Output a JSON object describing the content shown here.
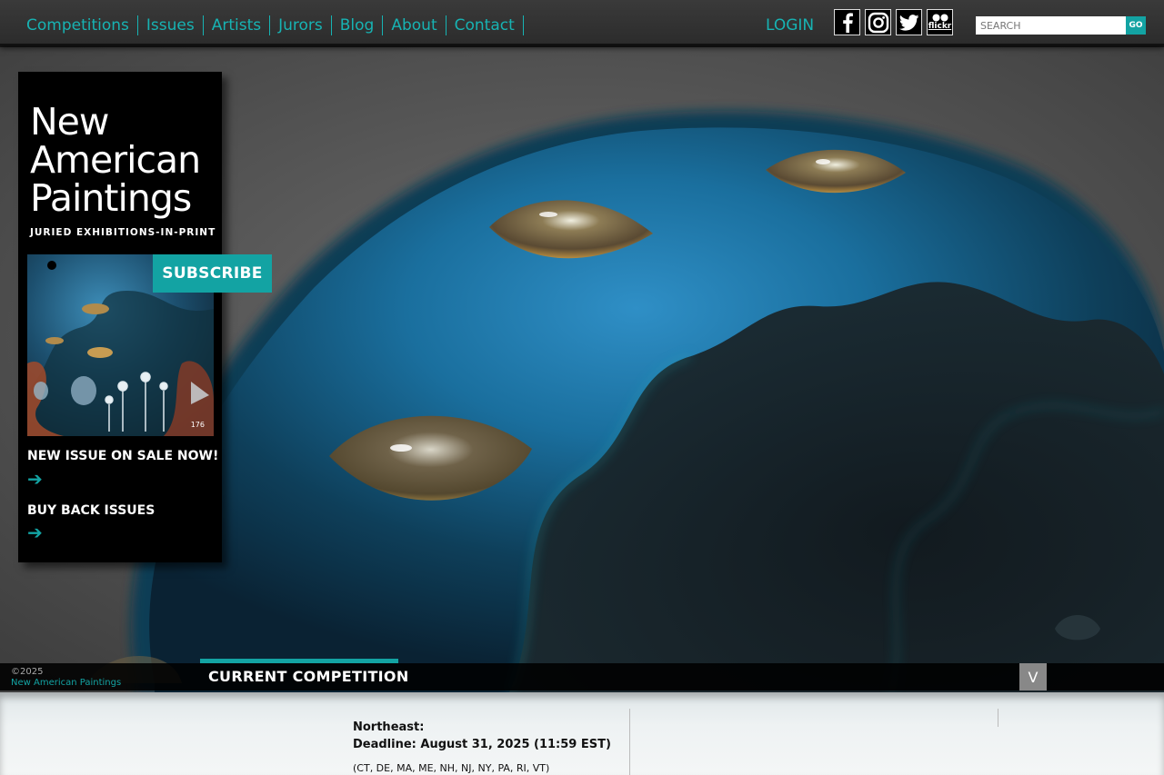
{
  "nav": {
    "items": [
      "Competitions",
      "Issues",
      "Artists",
      "Jurors",
      "Blog",
      "About",
      "Contact"
    ],
    "login": "LOGIN",
    "social": [
      "facebook-icon",
      "instagram-icon",
      "twitter-icon",
      "flickr-icon"
    ],
    "flickr_label": "flickr",
    "search_placeholder": "SEARCH",
    "search_button": "GO"
  },
  "sidebar": {
    "title_line1": "New",
    "title_line2": "American",
    "title_line3": "Paintings",
    "tagline": "JURIED EXHIBITIONS-IN-PRINT",
    "subscribe": "SUBSCRIBE",
    "cover_number": "176",
    "new_issue": "NEW ISSUE ON SALE NOW!",
    "back_issues": "BUY BACK ISSUES"
  },
  "footer": {
    "copyright_year": "©2025",
    "copyright_name": "New American Paintings",
    "current_tab": "CURRENT COMPETITION",
    "toggle": "V"
  },
  "competition": {
    "region": "Northeast:",
    "deadline": "Deadline: August 31, 2025 (11:59 EST)",
    "states": "(CT, DE, MA, ME, NH, NJ, NY, PA, RI, VT)"
  },
  "colors": {
    "accent": "#13a3a3",
    "nav_text": "#17b3b3",
    "nav_bg": "#333333",
    "sidebar_bg": "#000000"
  }
}
